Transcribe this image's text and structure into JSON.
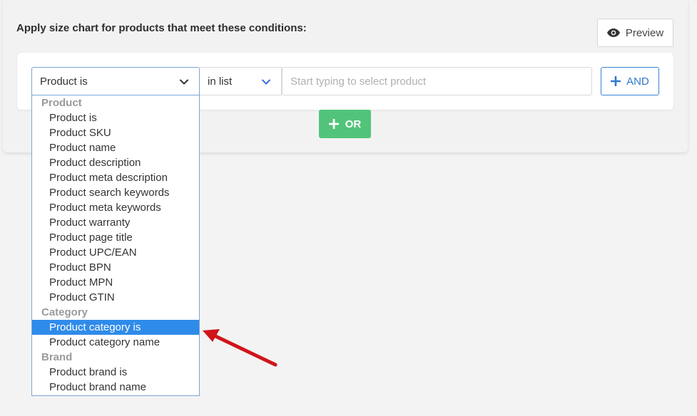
{
  "panel": {
    "title": "Apply size chart for products that meet these conditions:",
    "preview_label": "Preview"
  },
  "condition": {
    "field_value": "Product is",
    "operator_value": "in list",
    "value_placeholder": "Start typing to select product",
    "and_label": "AND"
  },
  "or_label": "OR",
  "dropdown": {
    "groups": [
      {
        "label": "Product",
        "options": [
          "Product is",
          "Product SKU",
          "Product name",
          "Product description",
          "Product meta description",
          "Product search keywords",
          "Product meta keywords",
          "Product warranty",
          "Product page title",
          "Product UPC/EAN",
          "Product BPN",
          "Product MPN",
          "Product GTIN"
        ]
      },
      {
        "label": "Category",
        "options": [
          "Product category is",
          "Product category name"
        ]
      },
      {
        "label": "Brand",
        "options": [
          "Product brand is",
          "Product brand name"
        ]
      }
    ],
    "highlighted": "Product category is"
  },
  "colors": {
    "accent_blue": "#2f78cf",
    "selected_bg": "#2f8bea",
    "or_green": "#52c47a",
    "annotation_red": "#d0141a"
  },
  "icons": {
    "preview": "eye-icon",
    "field_chevron": "chevron-down-icon",
    "operator_chevron": "chevron-down-icon",
    "and": "plus-icon",
    "or": "plus-icon",
    "annotation": "red-arrow"
  }
}
